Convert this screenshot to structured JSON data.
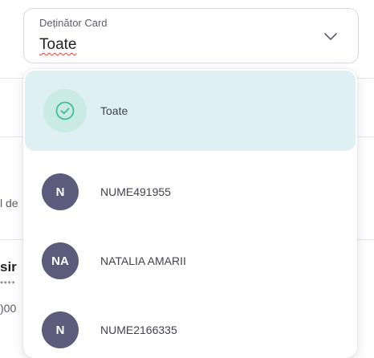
{
  "select": {
    "label": "Deținător Card",
    "value": "Toate"
  },
  "options": [
    {
      "label": "Toate",
      "selected": true,
      "icon": "check-circle-icon"
    },
    {
      "initials": "N",
      "label": "NUME491955"
    },
    {
      "initials": "NA",
      "label": "NATALIA AMARII"
    },
    {
      "initials": "N",
      "label": "NUME2166335"
    }
  ],
  "background": {
    "fragment_1": "l de",
    "fragment_2": "sir",
    "fragment_3": "****",
    "fragment_4": ")00"
  },
  "colors": {
    "accent_selected_bg": "#dff0f3",
    "check_green": "#3fbf9a",
    "avatar_bg": "#5b5c7c"
  }
}
